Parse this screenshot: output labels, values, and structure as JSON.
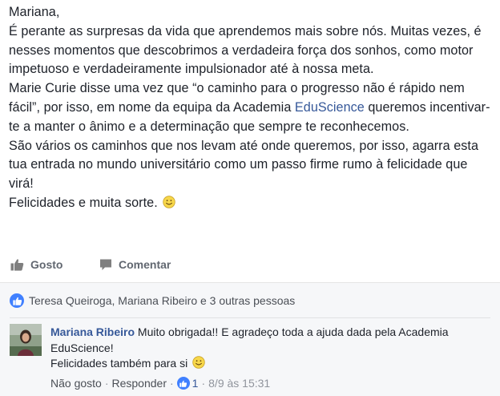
{
  "post": {
    "greeting": "Mariana,",
    "paragraph_1": "É perante as surpresas da vida que aprendemos mais sobre nós. Muitas vezes, é nesses momentos que descobrimos a verdadeira força dos sonhos, como motor impetuoso e verdadeiramente impulsionador até à nossa meta.",
    "paragraph_2_before": "Marie Curie disse uma vez que “o caminho para o progresso não é rápido nem fácil”, por isso, em nome da equipa da Academia ",
    "paragraph_2_link": "EduScience",
    "paragraph_2_after": " queremos incentivar-te a manter o ânimo e a determinação que sempre te reconhecemos.",
    "paragraph_3": "São vários os caminhos que nos levam até onde queremos, por isso, agarra esta tua entrada no mundo universitário como um passo firme rumo à felicidade que virá!",
    "closing": "Felicidades e muita sorte.",
    "smiley_icon": "smiley-icon"
  },
  "actions": {
    "like_label": "Gosto",
    "like_icon": "thumbs-up-icon",
    "comment_label": "Comentar",
    "comment_icon": "speech-bubble-icon"
  },
  "likes_summary": {
    "text": "Teresa Queiroga, Mariana Ribeiro e 3 outras pessoas",
    "icon": "thumbs-up-icon",
    "color": "#4080ff"
  },
  "comment": {
    "author": "Mariana Ribeiro",
    "text_line_1": "Muito obrigada!! E agradeço toda a ajuda dada pela Academia EduScience!",
    "text_line_2": "Felicidades também para si",
    "unlike_label": "Não gosto",
    "reply_label": "Responder",
    "like_count": "1",
    "timestamp": "8/9 às 15:31"
  },
  "colors": {
    "link": "#365899",
    "text": "#1d2129",
    "muted": "#616770",
    "like_blue": "#4080ff",
    "comment_bg": "#f6f7f9"
  }
}
